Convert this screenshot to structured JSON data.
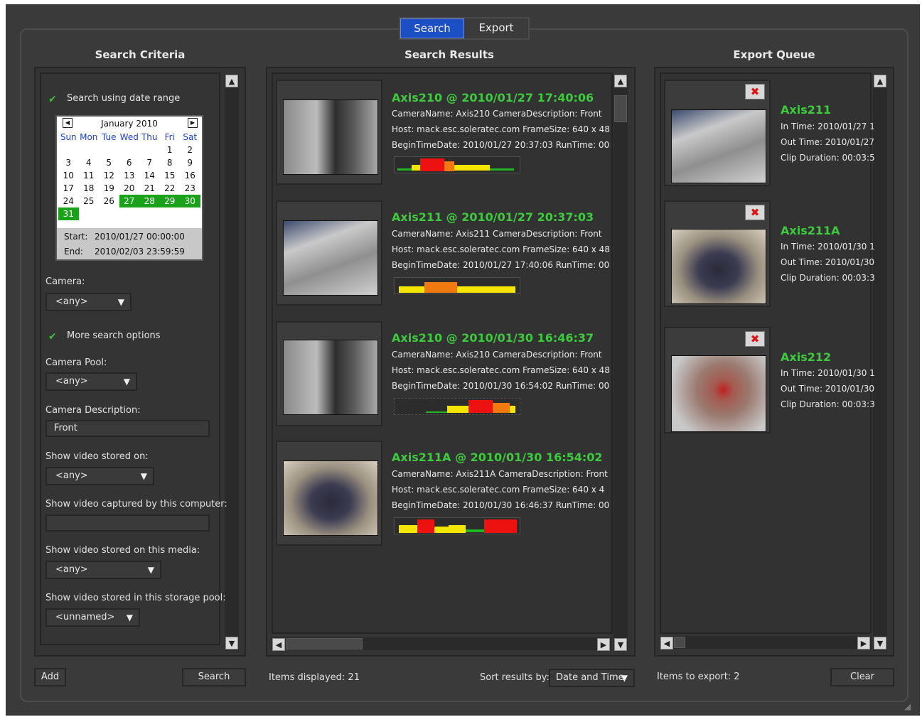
{
  "tabs": [
    {
      "label": "Search",
      "active": true
    },
    {
      "label": "Export",
      "active": false
    }
  ],
  "columns": {
    "criteria": "Search Criteria",
    "results": "Search Results",
    "queue": "Export Queue"
  },
  "criteria": {
    "date_range_label": "Search using date range",
    "date_range_checked": true,
    "calendar": {
      "month": "January 2010",
      "days_of_week": [
        "Sun",
        "Mon",
        "Tue",
        "Wed",
        "Thu",
        "Fri",
        "Sat"
      ],
      "weeks": [
        [
          "",
          "",
          "",
          "",
          "",
          "1",
          "2"
        ],
        [
          "3",
          "4",
          "5",
          "6",
          "7",
          "8",
          "9"
        ],
        [
          "10",
          "11",
          "12",
          "13",
          "14",
          "15",
          "16"
        ],
        [
          "17",
          "18",
          "19",
          "20",
          "21",
          "22",
          "23"
        ],
        [
          "24",
          "25",
          "26",
          "27",
          "28",
          "29",
          "30"
        ],
        [
          "31",
          "",
          "",
          "",
          "",
          "",
          ""
        ]
      ],
      "selected_days": [
        "27",
        "28",
        "29",
        "30",
        "31"
      ],
      "start_label": "Start:",
      "start_value": "2010/01/27  00:00:00",
      "end_label": "End:",
      "end_value": "2010/02/03  23:59:59"
    },
    "camera_label": "Camera:",
    "camera_value": "<any>",
    "more_options_label": "More search options",
    "more_options_checked": true,
    "camera_pool_label": "Camera Pool:",
    "camera_pool_value": "<any>",
    "camera_description_label": "Camera Description:",
    "camera_description_value": "Front",
    "stored_on_label": "Show video stored on:",
    "stored_on_value": "<any>",
    "captured_by_label": "Show video captured by this computer:",
    "captured_by_value": "",
    "stored_media_label": "Show video stored on this media:",
    "stored_media_value": "<any>",
    "storage_pool_label": "Show video stored in this storage pool:",
    "storage_pool_value": "<unnamed>"
  },
  "results": [
    {
      "title": "Axis210  @  2010/01/27 17:40:06",
      "camera_line": "CameraName: Axis210    CameraDescription: Front",
      "host_line": "Host: mack.esc.soleratec.com     FrameSize: 640 x 48",
      "begin_line": "BeginTimeDate: 2010/01/27 20:37:03    RunTime: 00"
    },
    {
      "title": "Axis211  @  2010/01/27 20:37:03",
      "camera_line": "CameraName: Axis211    CameraDescription: Front",
      "host_line": "Host: mack.esc.soleratec.com     FrameSize: 640 x 48",
      "begin_line": "BeginTimeDate: 2010/01/27 17:40:06    RunTime: 00"
    },
    {
      "title": "Axis210  @  2010/01/30 16:46:37",
      "camera_line": "CameraName: Axis210    CameraDescription: Front",
      "host_line": "Host: mack.esc.soleratec.com     FrameSize: 640 x 48",
      "begin_line": "BeginTimeDate: 2010/01/30 16:54:02    RunTime: 00"
    },
    {
      "title": "Axis211A  @  2010/01/30 16:54:02",
      "camera_line": "CameraName: Axis211A  CameraDescription: Front",
      "host_line": "Host: mack.esc.soleratec.com     FrameSize: 640 x 4",
      "begin_line": "BeginTimeDate: 2010/01/30 16:46:37    RunTime: 00"
    }
  ],
  "queue": [
    {
      "title": "Axis211",
      "in_time": "In Time: 2010/01/27 1",
      "out_time": "Out Time: 2010/01/27",
      "duration": "Clip Duration: 00:03:5"
    },
    {
      "title": "Axis211A",
      "in_time": "In Time: 2010/01/30 1",
      "out_time": "Out Time: 2010/01/30",
      "duration": "Clip Duration: 00:03:3"
    },
    {
      "title": "Axis212",
      "in_time": "In Time: 2010/01/30 1",
      "out_time": "Out Time: 2010/01/30",
      "duration": "Clip Duration: 00:03:3"
    }
  ],
  "footer": {
    "add_label": "Add",
    "search_label": "Search",
    "items_displayed": "Items displayed: 21",
    "sort_label": "Sort results by:",
    "sort_value": "Date and Time",
    "items_to_export": "Items to export: 2",
    "clear_label": "Clear"
  },
  "colors": {
    "title_green": "#3ec93e",
    "tab_active": "#1d4fc4",
    "bar_yellow": "#f5e600",
    "bar_red": "#ee1111",
    "bar_orange": "#f07a10",
    "bar_green": "#22b322"
  },
  "icons": {
    "scroll_up": "up-arrow-icon",
    "scroll_down": "down-arrow-icon",
    "remove": "red-x-icon",
    "dropdown": "chevron-down-icon"
  }
}
